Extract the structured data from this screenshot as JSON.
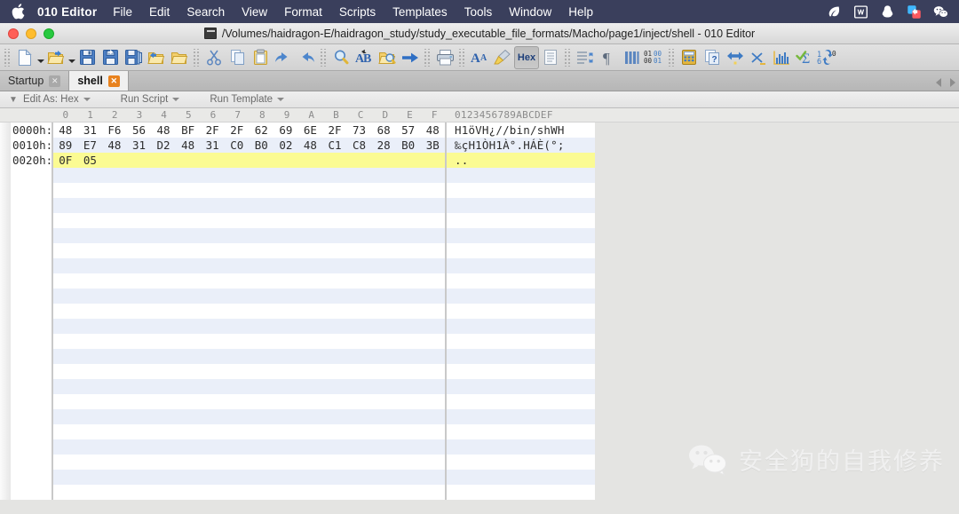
{
  "menubar": {
    "apple_icon": "apple-logo-icon",
    "app_name": "010 Editor",
    "items": [
      {
        "label": "File"
      },
      {
        "label": "Edit"
      },
      {
        "label": "Search"
      },
      {
        "label": "View"
      },
      {
        "label": "Format"
      },
      {
        "label": "Scripts"
      },
      {
        "label": "Templates"
      },
      {
        "label": "Tools"
      },
      {
        "label": "Window"
      },
      {
        "label": "Help"
      }
    ],
    "status_icons": [
      {
        "name": "leaf-icon"
      },
      {
        "name": "wps-office-icon"
      },
      {
        "name": "qq-penguin-icon"
      },
      {
        "name": "screen-switch-icon"
      },
      {
        "name": "wechat-icon"
      }
    ],
    "background_color": "#3a3f5c",
    "text_color": "#ffffff"
  },
  "titlebar": {
    "document_icon": "terminal-document-icon",
    "title": "/Volumes/haidragon-E/haidragon_study/study_executable_file_formats/Macho/page1/inject/shell - 010 Editor",
    "window_controls": [
      {
        "name": "close-button",
        "color": "#ff5f57"
      },
      {
        "name": "minimize-button",
        "color": "#ffbd2e"
      },
      {
        "name": "maximize-button",
        "color": "#28c940"
      }
    ]
  },
  "toolbar": {
    "buttons": [
      {
        "name": "new-file-icon",
        "dropdown": true
      },
      {
        "name": "open-file-icon",
        "dropdown": true
      },
      {
        "name": "save-icon",
        "dropdown": false
      },
      {
        "name": "save-as-icon",
        "dropdown": false
      },
      {
        "name": "save-all-icon",
        "dropdown": false
      },
      {
        "name": "open-folder-back-icon",
        "dropdown": false
      },
      {
        "name": "folder-icon",
        "dropdown": false
      },
      {
        "name": "cut-icon",
        "dropdown": false
      },
      {
        "name": "copy-icon",
        "dropdown": false
      },
      {
        "name": "paste-icon",
        "dropdown": false
      },
      {
        "name": "undo-icon",
        "dropdown": false
      },
      {
        "name": "redo-icon",
        "dropdown": false
      },
      {
        "name": "find-icon",
        "dropdown": false
      },
      {
        "name": "replace-icon",
        "dropdown": false
      },
      {
        "name": "find-in-files-icon",
        "dropdown": false
      },
      {
        "name": "goto-icon",
        "dropdown": false
      },
      {
        "name": "print-icon",
        "dropdown": false
      },
      {
        "name": "font-icon",
        "dropdown": false
      },
      {
        "name": "highlight-icon",
        "dropdown": false
      },
      {
        "name": "hex-mode-button",
        "label": "Hex",
        "dropdown": false
      },
      {
        "name": "text-view-icon",
        "dropdown": false
      },
      {
        "name": "line-wrap-icon",
        "dropdown": false
      },
      {
        "name": "paragraph-icon",
        "dropdown": false
      },
      {
        "name": "columns-icon",
        "dropdown": false
      },
      {
        "name": "binary-view-icon",
        "dropdown": false
      },
      {
        "name": "calculator-icon",
        "dropdown": false
      },
      {
        "name": "inspector-icon",
        "dropdown": false
      },
      {
        "name": "compare-icon",
        "dropdown": false
      },
      {
        "name": "checksum-icon",
        "dropdown": false
      },
      {
        "name": "histogram-icon",
        "dropdown": false
      },
      {
        "name": "script-check-icon",
        "dropdown": false
      },
      {
        "name": "base-convert-icon",
        "dropdown": false
      }
    ],
    "hex_badge_label": "Hex",
    "binary_badge_top": "0100",
    "binary_badge_bottom": "0001",
    "base_convert_top": "10",
    "base_convert_bottom": "16"
  },
  "tabs": {
    "items": [
      {
        "label": "Startup",
        "active": false,
        "close_icon": "close-tab-icon"
      },
      {
        "label": "shell",
        "active": true,
        "close_icon": "close-tab-icon"
      }
    ],
    "nav_left": "tab-scroll-left-icon",
    "nav_right": "tab-scroll-right-icon"
  },
  "actionbar": {
    "collapse_icon": "collapse-toolbar-icon",
    "items": [
      {
        "label": "Edit As: Hex",
        "has_caret": true
      },
      {
        "label": "Run Script",
        "has_caret": true
      },
      {
        "label": "Run Template",
        "has_caret": true
      }
    ]
  },
  "hexview": {
    "column_headers": [
      "0",
      "1",
      "2",
      "3",
      "4",
      "5",
      "6",
      "7",
      "8",
      "9",
      "A",
      "B",
      "C",
      "D",
      "E",
      "F"
    ],
    "ascii_header": "0123456789ABCDEF",
    "rows": [
      {
        "address": "0000h:",
        "bytes": [
          "48",
          "31",
          "F6",
          "56",
          "48",
          "BF",
          "2F",
          "2F",
          "62",
          "69",
          "6E",
          "2F",
          "73",
          "68",
          "57",
          "48"
        ],
        "ascii": "H1öVH¿//bin/shWH",
        "stripe": "even",
        "selected": false
      },
      {
        "address": "0010h:",
        "bytes": [
          "89",
          "E7",
          "48",
          "31",
          "D2",
          "48",
          "31",
          "C0",
          "B0",
          "02",
          "48",
          "C1",
          "C8",
          "28",
          "B0",
          "3B"
        ],
        "ascii": "‰çH1ÒH1À°.HÁÈ(°;",
        "stripe": "odd",
        "selected": false
      },
      {
        "address": "0020h:",
        "bytes": [
          "0F",
          "05"
        ],
        "ascii": "..",
        "stripe": "even",
        "selected": true
      }
    ],
    "empty_row_count": 22,
    "selection_color": "#fbfb93",
    "stripe_color": "#eaeff9",
    "background_color": "#e4e4e2"
  },
  "watermark": {
    "logo": "wechat-logo-icon",
    "text": "安全狗的自我修养"
  }
}
